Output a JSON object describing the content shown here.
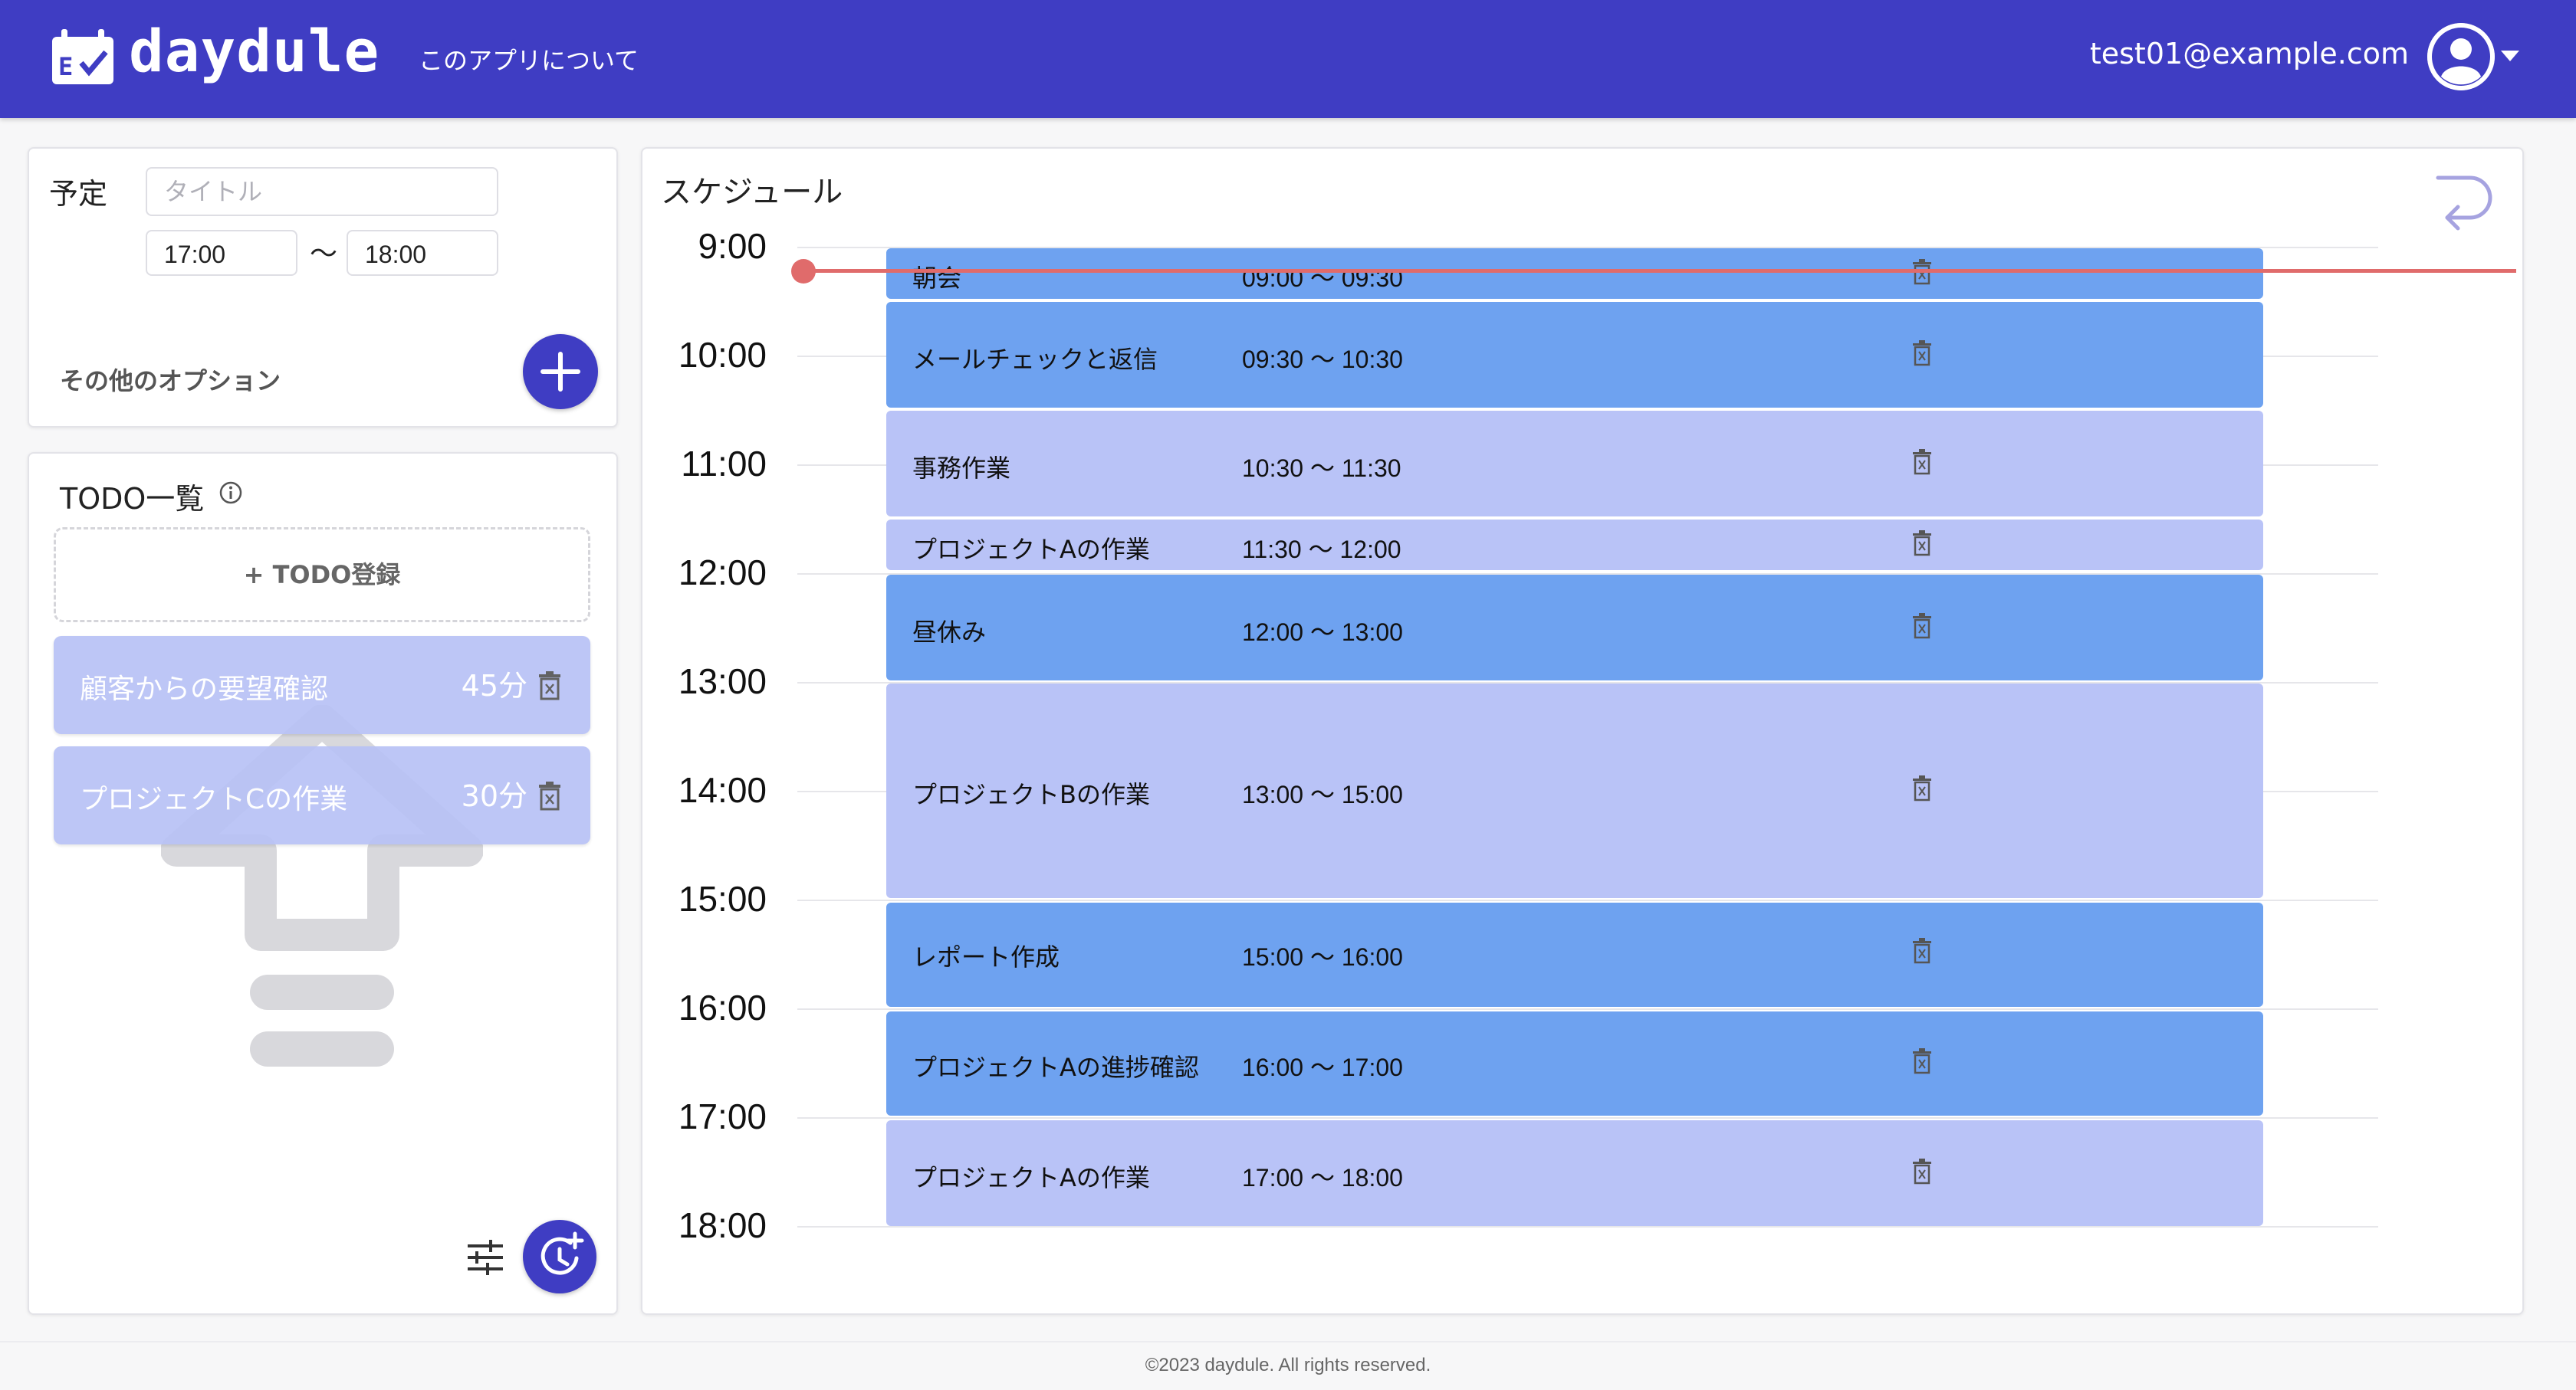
{
  "header": {
    "app_name": "daydule",
    "about_link": "このアプリについて",
    "user_email": "test01@example.com",
    "brand_color": "#3f3dc3"
  },
  "schedule_form": {
    "label": "予定",
    "title_placeholder": "タイトル",
    "start_time": "17:00",
    "separator": "〜",
    "end_time": "18:00",
    "more_options": "その他のオプション"
  },
  "todo": {
    "heading": "TODO一覧",
    "add_button": "+ TODO登録",
    "items": [
      {
        "title": "顧客からの要望確認",
        "duration": "45分"
      },
      {
        "title": "プロジェクトCの作業",
        "duration": "30分"
      }
    ]
  },
  "schedule": {
    "heading": "スケジュール",
    "hours": [
      "9:00",
      "10:00",
      "11:00",
      "12:00",
      "13:00",
      "14:00",
      "15:00",
      "16:00",
      "17:00",
      "18:00"
    ],
    "events": [
      {
        "title": "朝会",
        "range": "09:00 〜 09:30",
        "style": "dark"
      },
      {
        "title": "メールチェックと返信",
        "range": "09:30 〜 10:30",
        "style": "dark"
      },
      {
        "title": "事務作業",
        "range": "10:30 〜 11:30",
        "style": "light"
      },
      {
        "title": "プロジェクトAの作業",
        "range": "11:30 〜 12:00",
        "style": "light"
      },
      {
        "title": "昼休み",
        "range": "12:00 〜 13:00",
        "style": "dark"
      },
      {
        "title": "プロジェクトBの作業",
        "range": "13:00 〜 15:00",
        "style": "light"
      },
      {
        "title": "レポート作成",
        "range": "15:00 〜 16:00",
        "style": "dark"
      },
      {
        "title": "プロジェクトAの進捗確認",
        "range": "16:00 〜 17:00",
        "style": "dark"
      },
      {
        "title": "プロジェクトAの作業",
        "range": "17:00 〜 18:00",
        "style": "light"
      }
    ],
    "current_time_color": "#e06b6b"
  },
  "footer": {
    "copyright": "©2023 daydule. All rights reserved."
  }
}
